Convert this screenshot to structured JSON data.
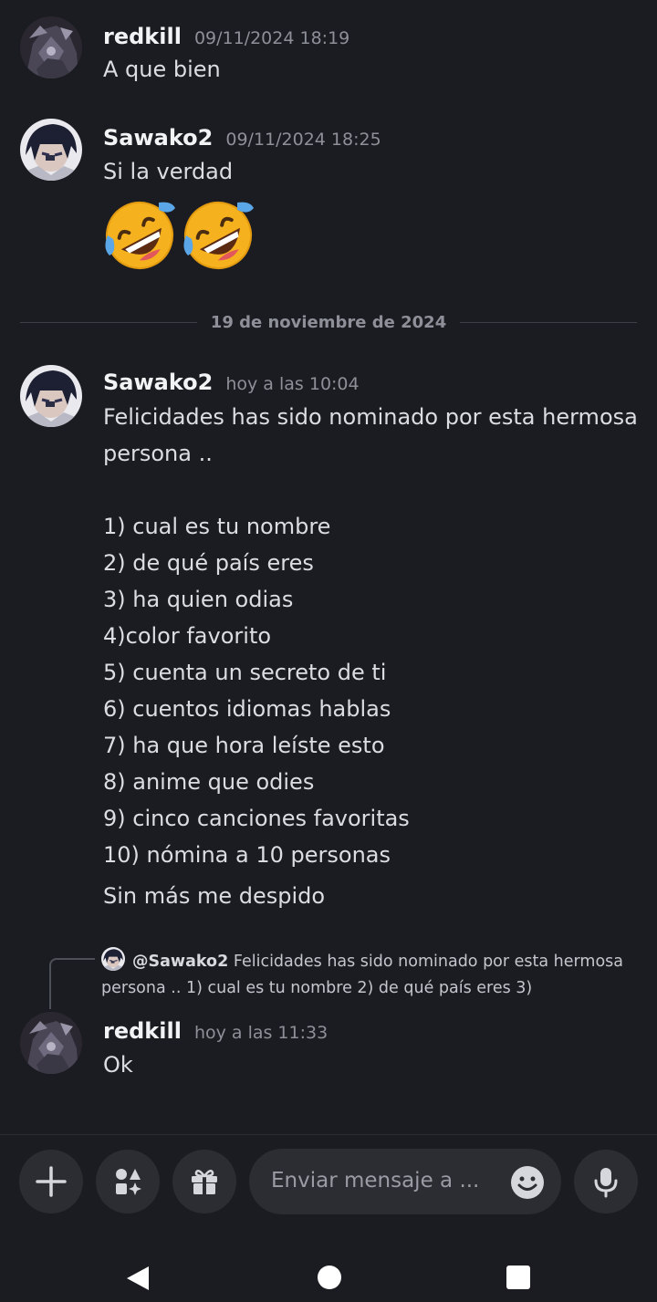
{
  "messages": [
    {
      "user": "redkill",
      "time": "09/11/2024 18:19",
      "text": "A que bien"
    },
    {
      "user": "Sawako2",
      "time": "09/11/2024 18:25",
      "text": "Si la verdad",
      "emojis": [
        "rofl-emoji",
        "rofl-emoji"
      ]
    },
    {
      "user": "Sawako2",
      "time": "hoy a las 10:04",
      "lines": [
        "Felicidades has sido nominado por esta hermosa",
        "persona ..",
        "",
        "1) cual es tu nombre",
        "2) de qué país eres",
        "3) ha quien odias",
        "4)color favorito",
        "5) cuenta un secreto de ti",
        "6) cuentos idiomas hablas",
        "7) ha que hora leíste esto",
        "8) anime que odies",
        "9) cinco canciones favoritas",
        "10) nómina a 10 personas"
      ],
      "closing": "Sin más me despido"
    },
    {
      "user": "redkill",
      "time": "hoy a las 11:33",
      "text": "Ok",
      "reply": {
        "mention": "@Sawako2",
        "preview": "Felicidades has sido nominado por esta hermosa persona ..  1) cual es tu nombre  2) de qué país eres 3)"
      }
    }
  ],
  "divider": {
    "label": "19 de noviembre de 2024"
  },
  "composer": {
    "placeholder": "Enviar mensaje a ...",
    "buttons": [
      "plus-icon",
      "apps-icon",
      "gift-icon",
      "emoji-icon",
      "microphone-icon"
    ]
  },
  "colors": {
    "background": "#1b1c21",
    "input": "#2b2d33",
    "muted": "#8e9099"
  }
}
